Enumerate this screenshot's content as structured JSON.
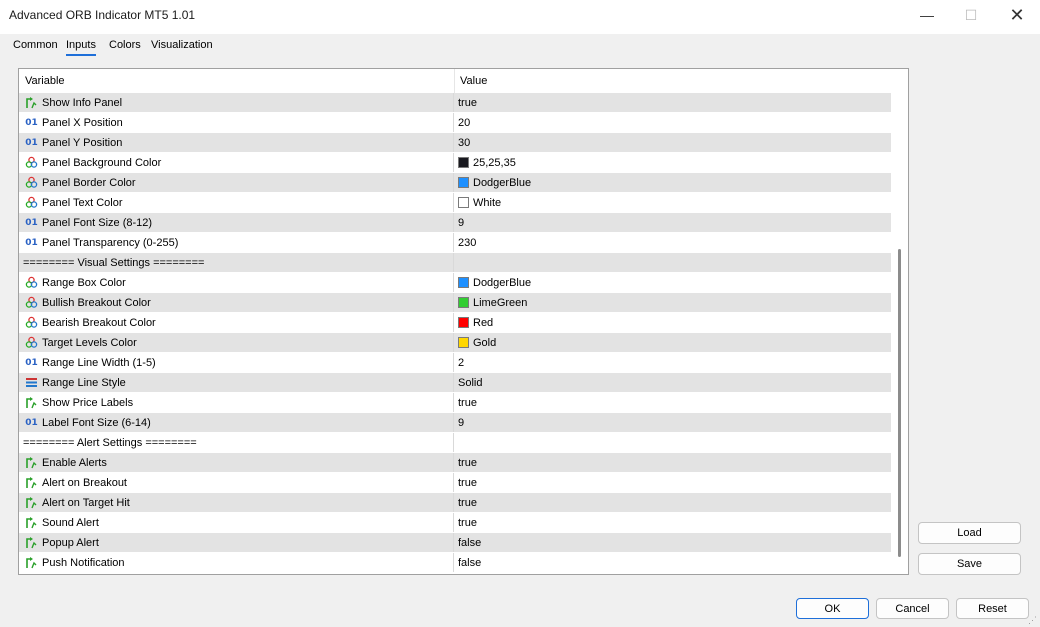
{
  "window": {
    "title": "Advanced ORB Indicator MT5 1.01",
    "minimize_glyph": "—",
    "maximize_glyph": "☐",
    "close_glyph": "✕"
  },
  "tabs": [
    {
      "label": "Common",
      "active": false
    },
    {
      "label": "Inputs",
      "active": true
    },
    {
      "label": "Colors",
      "active": false
    },
    {
      "label": "Visualization",
      "active": false
    }
  ],
  "grid": {
    "col_variable": "Variable",
    "col_value": "Value",
    "rows": [
      {
        "icon": "bool-icon",
        "name": "Show Info Panel",
        "value": "true"
      },
      {
        "icon": "int-icon",
        "name": "Panel X Position",
        "value": "20"
      },
      {
        "icon": "int-icon",
        "name": "Panel Y Position",
        "value": "30"
      },
      {
        "icon": "color-icon",
        "name": "Panel Background Color",
        "value": "25,25,35",
        "swatch": "#19191f"
      },
      {
        "icon": "color-icon",
        "name": "Panel Border Color",
        "value": "DodgerBlue",
        "swatch": "#1e90ff"
      },
      {
        "icon": "color-icon",
        "name": "Panel Text Color",
        "value": "White",
        "swatch": "#ffffff"
      },
      {
        "icon": "int-icon",
        "name": "Panel Font Size (8-12)",
        "value": "9"
      },
      {
        "icon": "int-icon",
        "name": "Panel Transparency (0-255)",
        "value": "230"
      },
      {
        "icon": "none",
        "name": "======== Visual Settings ========",
        "value": ""
      },
      {
        "icon": "color-icon",
        "name": "Range Box Color",
        "value": "DodgerBlue",
        "swatch": "#1e90ff"
      },
      {
        "icon": "color-icon",
        "name": "Bullish Breakout Color",
        "value": "LimeGreen",
        "swatch": "#32cd32"
      },
      {
        "icon": "color-icon",
        "name": "Bearish Breakout Color",
        "value": "Red",
        "swatch": "#ff0000"
      },
      {
        "icon": "color-icon",
        "name": "Target Levels Color",
        "value": "Gold",
        "swatch": "#ffd700"
      },
      {
        "icon": "int-icon",
        "name": "Range Line Width (1-5)",
        "value": "2"
      },
      {
        "icon": "enum-icon",
        "name": "Range Line Style",
        "value": "Solid"
      },
      {
        "icon": "bool-icon",
        "name": "Show Price Labels",
        "value": "true"
      },
      {
        "icon": "int-icon",
        "name": "Label Font Size (6-14)",
        "value": "9"
      },
      {
        "icon": "none",
        "name": "======== Alert Settings ========",
        "value": ""
      },
      {
        "icon": "bool-icon",
        "name": "Enable Alerts",
        "value": "true"
      },
      {
        "icon": "bool-icon",
        "name": "Alert on Breakout",
        "value": "true"
      },
      {
        "icon": "bool-icon",
        "name": "Alert on Target Hit",
        "value": "true"
      },
      {
        "icon": "bool-icon",
        "name": "Sound Alert",
        "value": "true"
      },
      {
        "icon": "bool-icon",
        "name": "Popup Alert",
        "value": "false"
      },
      {
        "icon": "bool-icon",
        "name": "Push Notification",
        "value": "false"
      }
    ]
  },
  "side_buttons": {
    "load": "Load",
    "save": "Save"
  },
  "bottom_buttons": {
    "ok": "OK",
    "cancel": "Cancel",
    "reset": "Reset"
  },
  "colors": {
    "accent": "#1e6fd9",
    "row_shade": "#e3e3e3",
    "bool_icon": "#2aa02a",
    "int_icon": "#2b62c4"
  }
}
